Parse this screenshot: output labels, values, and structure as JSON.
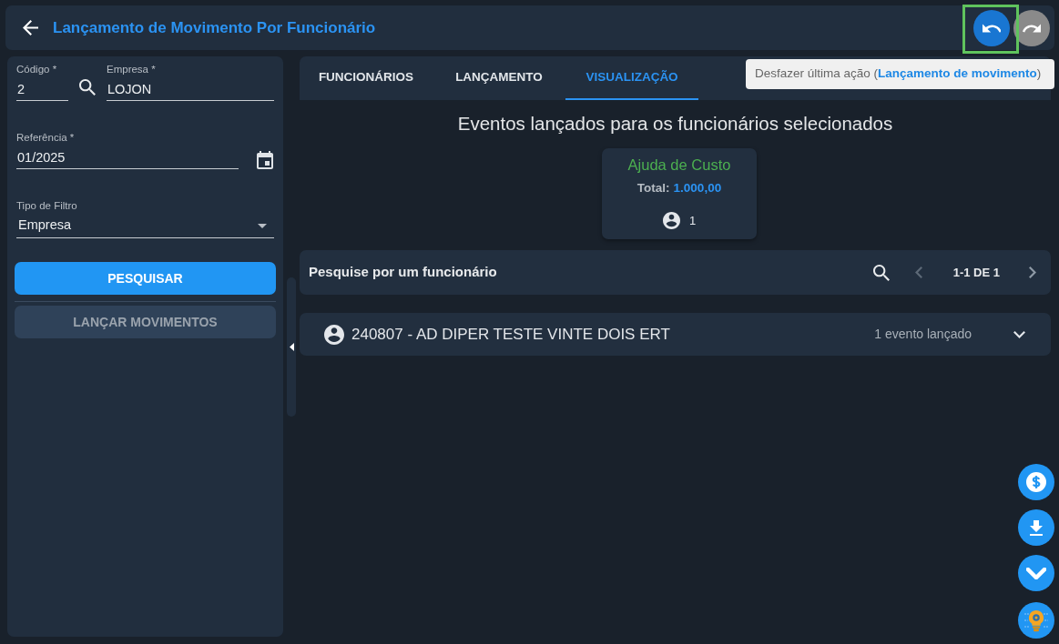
{
  "header": {
    "title": "Lançamento de Movimento Por Funcionário",
    "undo": {
      "disabled": false,
      "highlighted": true
    },
    "redo": {
      "disabled": true
    }
  },
  "tooltip": {
    "text": "Desfazer última ação (**Lançamento de movimento**)"
  },
  "form": {
    "rows": [
      {
        "fields": [
          {
            "kind": "lookup",
            "label": "Código *",
            "value": "2"
          },
          {
            "kind": "text",
            "label": "Empresa *",
            "value": "LOJON"
          }
        ]
      },
      {
        "fields": [
          {
            "kind": "date",
            "label": "Referência *",
            "value": "01/2025"
          }
        ]
      },
      {
        "fields": [
          {
            "kind": "select",
            "label": "Tipo de Filtro",
            "value": "Empresa"
          }
        ]
      }
    ],
    "buttons": [
      {
        "label": "PESQUISAR",
        "disabled": false
      },
      {
        "label": "LANÇAR MOVIMENTOS",
        "disabled": true
      }
    ]
  },
  "tabs": [
    {
      "label": "FUNCIONÁRIOS",
      "selected": false
    },
    {
      "label": "LANÇAMENTO",
      "selected": false
    },
    {
      "label": "VISUALIZAÇÃO",
      "selected": true
    }
  ],
  "summary": {
    "heading": "Eventos lançados para os funcionários selecionados",
    "cards": [
      {
        "title": "Ajuda de Custo",
        "total_label": "Total:",
        "total": "1.000,00",
        "count": "1"
      }
    ]
  },
  "search_bar": {
    "label": "Pesquise por um funcionário",
    "pagination": "1-1 DE 1",
    "prev": {
      "disabled": true
    },
    "next": {
      "disabled": false
    }
  },
  "employees": [
    {
      "name": "240807 - AD DIPER TESTE VINTE DOIS ERT",
      "events": "1 evento lançado",
      "expanded": false
    }
  ]
}
